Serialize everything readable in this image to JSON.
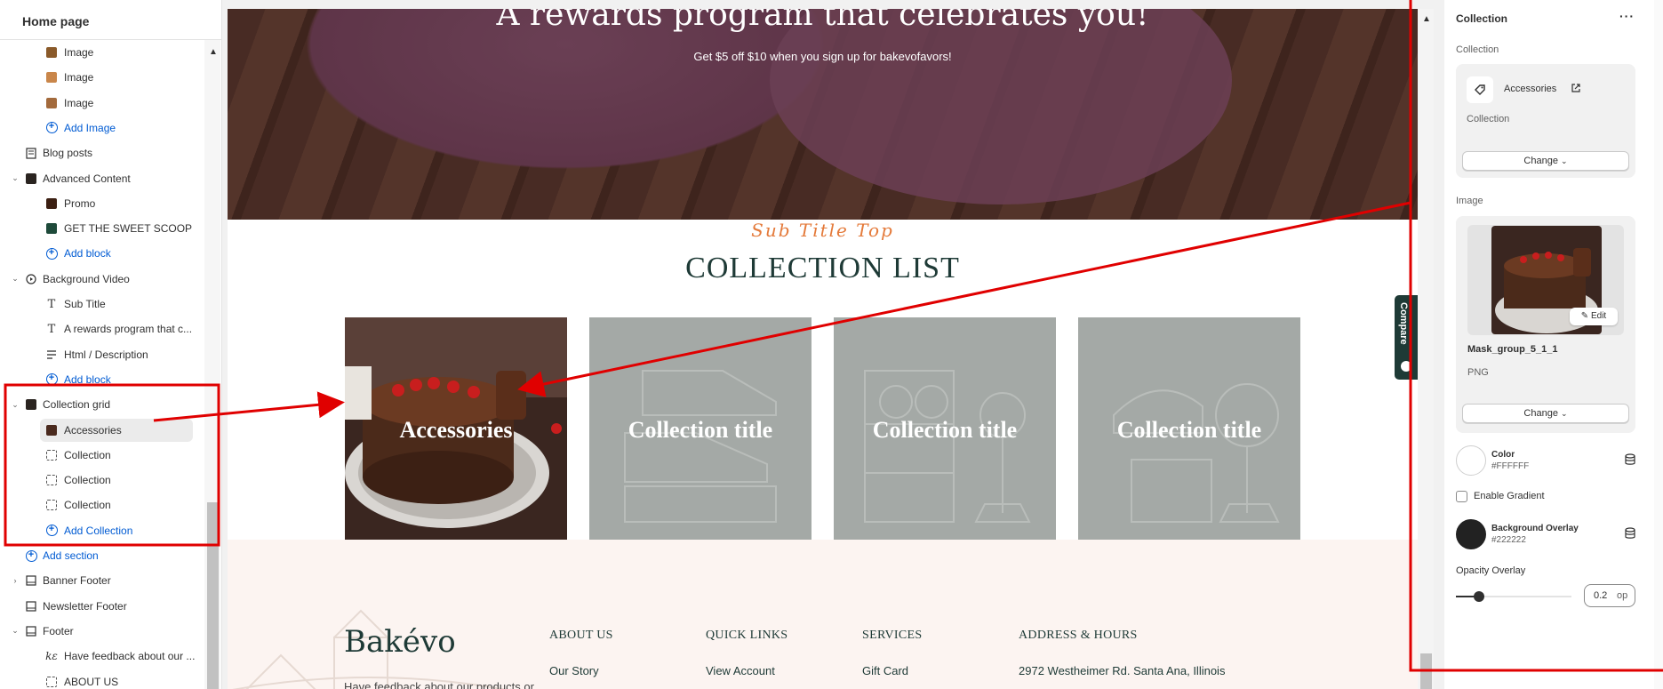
{
  "sidebar": {
    "title": "Home page",
    "items": [
      {
        "label": "Image",
        "kind": "thumb",
        "color": "#8a5a2a",
        "level": 2
      },
      {
        "label": "Image",
        "kind": "thumb",
        "color": "#c9864a",
        "level": 2
      },
      {
        "label": "Image",
        "kind": "thumb",
        "color": "#a36a3c",
        "level": 2
      },
      {
        "label": "Add Image",
        "kind": "add",
        "level": 2
      },
      {
        "label": "Blog posts",
        "kind": "doc",
        "level": 1
      },
      {
        "label": "Advanced Content",
        "kind": "section",
        "level": 1
      },
      {
        "label": "Promo",
        "kind": "thumb",
        "color": "#3b1f12",
        "level": 2
      },
      {
        "label": "GET THE SWEET SCOOP",
        "kind": "thumb",
        "color": "#1e4a3a",
        "level": 2
      },
      {
        "label": "Add block",
        "kind": "add",
        "level": 2
      },
      {
        "label": "Background Video",
        "kind": "video",
        "level": 1
      },
      {
        "label": "Sub Title",
        "kind": "text",
        "level": 2
      },
      {
        "label": "A rewards program that c...",
        "kind": "text",
        "level": 2
      },
      {
        "label": "Html / Description",
        "kind": "lines",
        "level": 2
      },
      {
        "label": "Add block",
        "kind": "add",
        "level": 2
      },
      {
        "label": "Collection grid",
        "kind": "section",
        "level": 1
      },
      {
        "label": "Accessories",
        "kind": "thumb",
        "color": "#4a2a1e",
        "level": 2
      },
      {
        "label": "Collection",
        "kind": "dashed",
        "level": 2
      },
      {
        "label": "Collection",
        "kind": "dashed",
        "level": 2
      },
      {
        "label": "Collection",
        "kind": "dashed",
        "level": 2
      },
      {
        "label": "Add Collection",
        "kind": "add",
        "level": 2
      },
      {
        "label": "Add section",
        "kind": "add",
        "level": 0
      },
      {
        "label": "Banner Footer",
        "kind": "banner",
        "level": 1
      },
      {
        "label": "Newsletter Footer",
        "kind": "banner",
        "level": 1
      },
      {
        "label": "Footer",
        "kind": "banner",
        "level": 1
      },
      {
        "label": "Have feedback about our ...",
        "kind": "logo",
        "level": 2
      },
      {
        "label": "ABOUT US",
        "kind": "dashed",
        "level": 2
      }
    ]
  },
  "preview": {
    "hero_title": "A rewards program that celebrates you!",
    "hero_subtitle": "Get $5 off $10 when you sign up for bakevofavors!",
    "subtitle_top": "Sub Title Top",
    "collection_heading": "COLLECTION LIST",
    "cards": [
      {
        "title": "Accessories"
      },
      {
        "title": "Collection title"
      },
      {
        "title": "Collection title"
      },
      {
        "title": "Collection title"
      }
    ],
    "footer": {
      "logo": "Bakévo",
      "feedback": "Have feedback about our products or",
      "columns": [
        {
          "heading": "ABOUT US",
          "first_item": "Our Story"
        },
        {
          "heading": "QUICK LINKS",
          "first_item": "View Account"
        },
        {
          "heading": "SERVICES",
          "first_item": "Gift Card"
        },
        {
          "heading": "ADDRESS & HOURS",
          "first_item": "2972 Westheimer Rd. Santa Ana, Illinois"
        }
      ]
    },
    "compare_tab": "Compare"
  },
  "panel": {
    "title": "Collection",
    "more": "···",
    "collection_label": "Collection",
    "collection_name": "Accessories",
    "collection_type": "Collection",
    "change_label": "Change",
    "image_label": "Image",
    "image_name": "Mask_group_5_1_1",
    "image_type": "PNG",
    "edit_label": "Edit",
    "color": {
      "name": "Color",
      "hex": "#FFFFFF"
    },
    "enable_gradient": "Enable Gradient",
    "overlay": {
      "name": "Background Overlay",
      "hex": "#222222"
    },
    "opacity_label": "Opacity Overlay",
    "opacity_value": "0.2",
    "opacity_unit": "op",
    "opacity_fraction": 0.2
  },
  "colors": {
    "accent": "#005bd3",
    "annotation": "#e00000",
    "brand_green": "#1e3a36",
    "subtitle_orange": "#e47a3a"
  }
}
